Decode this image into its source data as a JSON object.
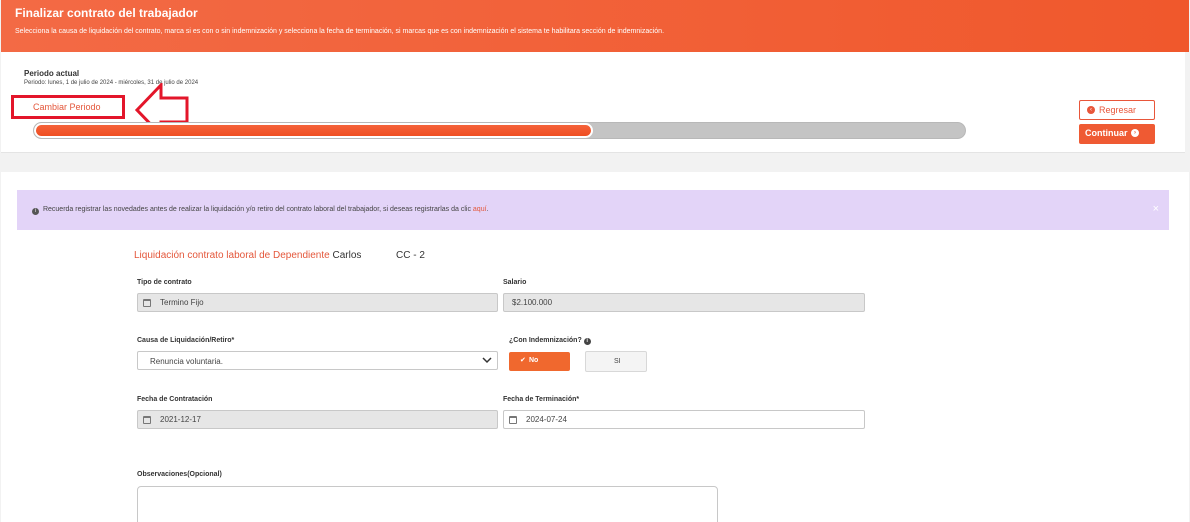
{
  "header": {
    "title": "Finalizar contrato del trabajador",
    "subtitle": "Selecciona la causa de liquidación del contrato, marca si es con o sin indemnización y selecciona la fecha de terminación, si marcas que es con indemnización el sistema te habilitara sección de indemnización."
  },
  "period": {
    "label": "Periodo actual",
    "detail": "Periodo: lunes, 1 de julio de 2024 - miércoles, 31 de julio de 2024",
    "change_label": "Cambiar Periodo",
    "progress": 0.6
  },
  "actions": {
    "back_label": "Regresar",
    "continue_label": "Continuar"
  },
  "alert": {
    "text_before": "Recuerda registrar las novedades antes de realizar la liquidación y/o retiro del contrato laboral del trabajador, si deseas registrarlas da clic ",
    "link": "aquí",
    "text_after": ".",
    "close": "×"
  },
  "form": {
    "title": "Liquidación contrato laboral de Dependiente",
    "worker_name": "Carlos",
    "doc_id": "CC - 2",
    "contract_type_label": "Tipo de contrato",
    "contract_type_value": "Termino Fijo",
    "salary_label": "Salario",
    "salary_value": "$2.100.000",
    "cause_label": "Causa de Liquidación/Retiro*",
    "cause_value": "Renuncia voluntaria.",
    "indemnity_label": "¿Con Indemnización?",
    "no_label": "No",
    "si_label": "SI",
    "hire_date_label": "Fecha de Contratación",
    "hire_date_value": "2021-12-17",
    "end_date_label": "Fecha de Terminación*",
    "end_date_value": "2024-07-24",
    "observations_label": "Observaciones(Opcional)"
  },
  "colors": {
    "brand": "#f0582c",
    "annotation": "#e3162a",
    "alert_bg": "#e3d4f8"
  }
}
